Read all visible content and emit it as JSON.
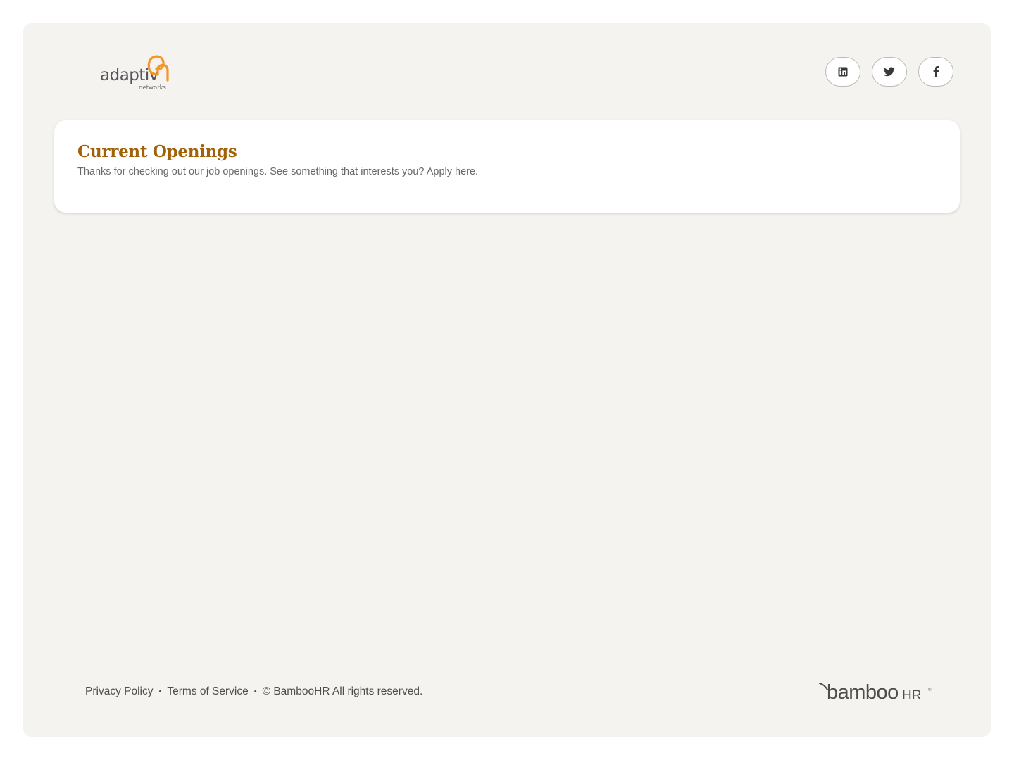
{
  "company": {
    "logo_text": "adaptiv",
    "logo_subtext": "networks"
  },
  "social": {
    "linkedin_icon": "linkedin-icon",
    "twitter_icon": "twitter-icon",
    "facebook_icon": "facebook-icon"
  },
  "openings": {
    "title": "Current Openings",
    "description": "Thanks for checking out our job openings. See something that interests you? Apply here."
  },
  "footer": {
    "privacy_label": "Privacy Policy",
    "terms_label": "Terms of Service",
    "copyright": "© BambooHR All rights reserved.",
    "separator": "•",
    "brand_main": "bamboo",
    "brand_suffix": "HR",
    "brand_reg": "®"
  },
  "colors": {
    "accent": "#a06108",
    "logo_orange": "#f2962a",
    "panel_bg": "#f5f3f0",
    "text_gray": "#6a6764"
  }
}
